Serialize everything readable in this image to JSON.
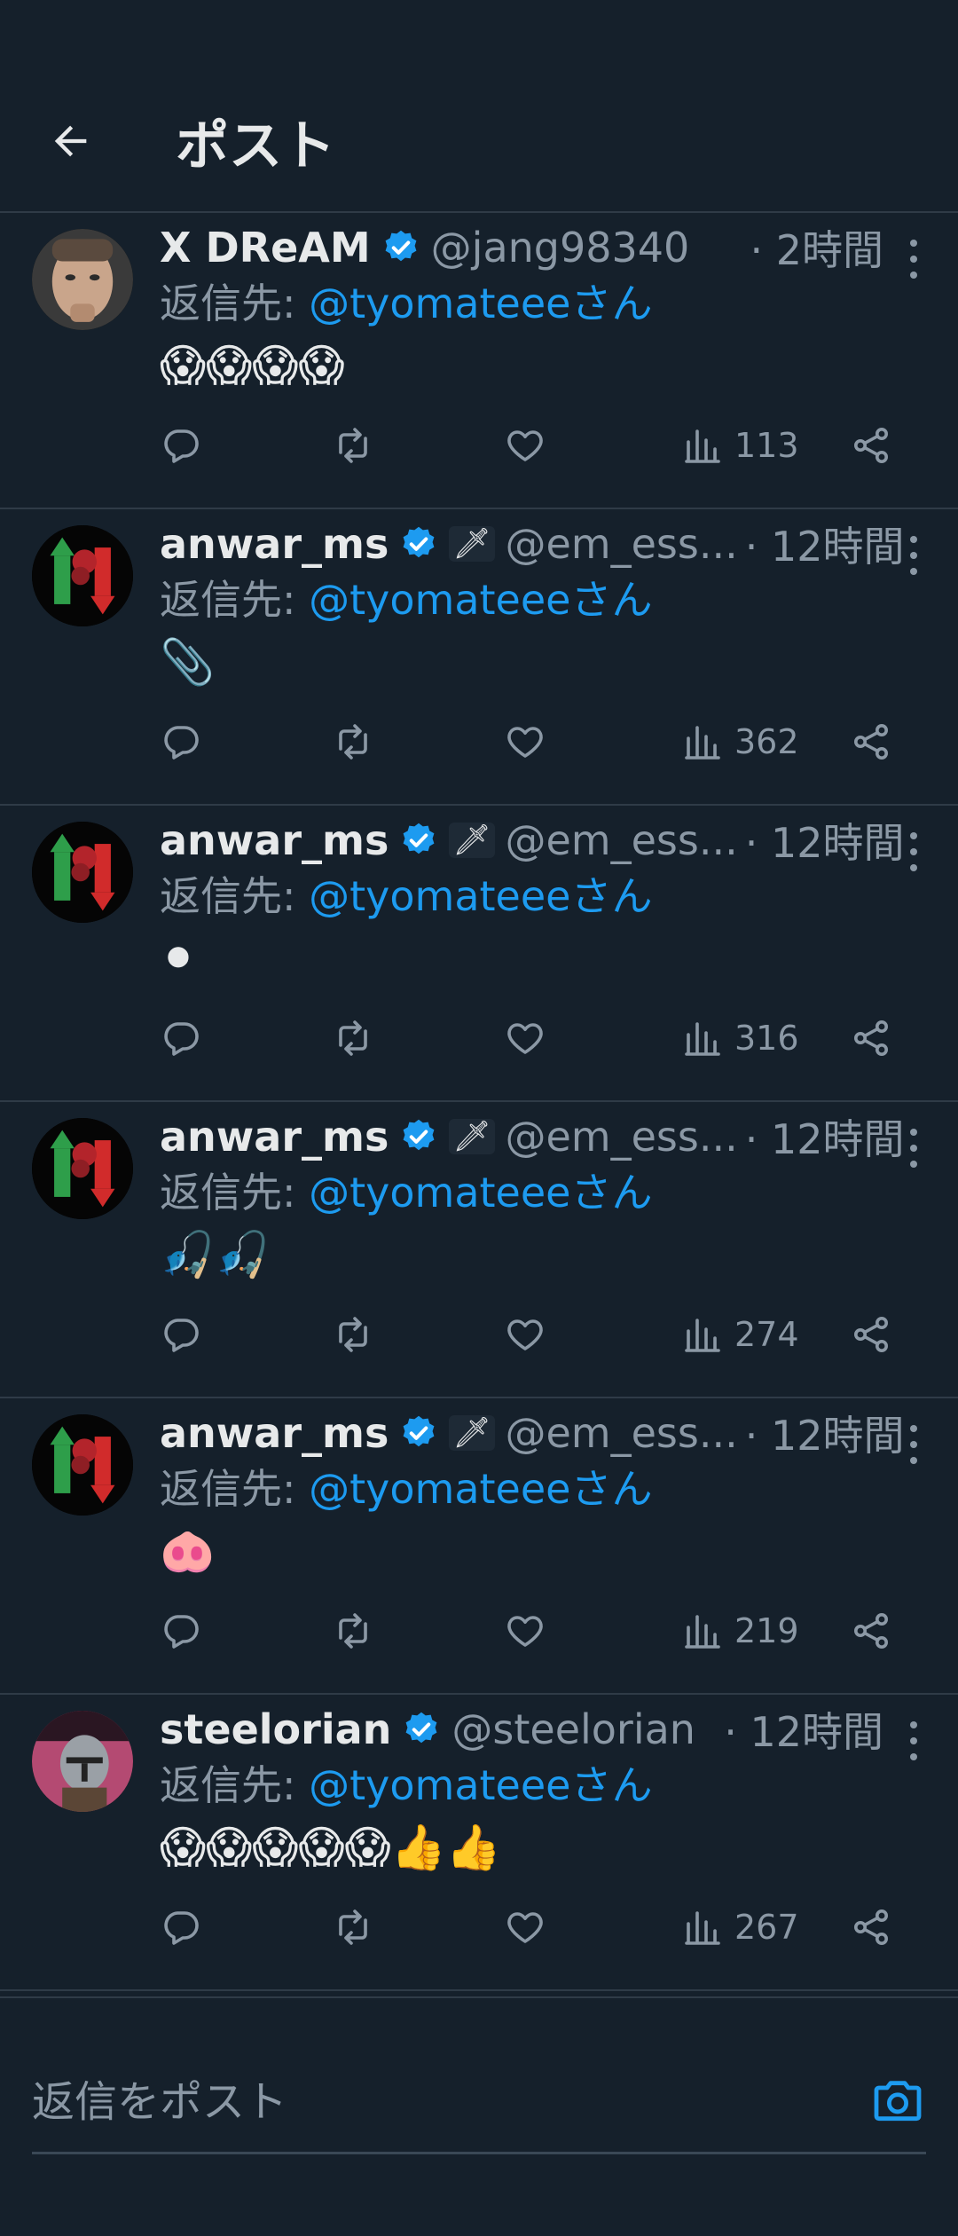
{
  "header": {
    "title": "ポスト"
  },
  "posts": [
    {
      "name": "X DReAM",
      "handle": "@jang98340",
      "time": "· 2時間",
      "reply_prefix": "返信先: ",
      "reply_to": "@tyomateeeさん",
      "content": "😱😱😱😱",
      "views": "113",
      "avatar": "face",
      "sword": false
    },
    {
      "name": "anwar_ms",
      "handle": "@em_ess...",
      "time": "· 12時間",
      "reply_prefix": "返信先: ",
      "reply_to": "@tyomateeeさん",
      "content": "📎",
      "views": "362",
      "avatar": "chart",
      "sword": true
    },
    {
      "name": "anwar_ms",
      "handle": "@em_ess...",
      "time": "· 12時間",
      "reply_prefix": "返信先: ",
      "reply_to": "@tyomateeeさん",
      "content": "⚫",
      "views": "316",
      "avatar": "chart",
      "sword": true
    },
    {
      "name": "anwar_ms",
      "handle": "@em_ess...",
      "time": "· 12時間",
      "reply_prefix": "返信先: ",
      "reply_to": "@tyomateeeさん",
      "content": "🎣🎣",
      "views": "274",
      "avatar": "chart",
      "sword": true
    },
    {
      "name": "anwar_ms",
      "handle": "@em_ess...",
      "time": "· 12時間",
      "reply_prefix": "返信先: ",
      "reply_to": "@tyomateeeさん",
      "content": "🐽",
      "views": "219",
      "avatar": "chart",
      "sword": true
    },
    {
      "name": "steelorian",
      "handle": "@steelorian",
      "time": "· 12時間",
      "reply_prefix": "返信先: ",
      "reply_to": "@tyomateeeさん",
      "content": "😱😱😱😱😱👍👍",
      "views": "267",
      "avatar": "helmet",
      "sword": false
    }
  ],
  "sword_glyph": "🗡",
  "reply_box": {
    "placeholder": "返信をポスト"
  },
  "colors": {
    "background": "#15202b",
    "accent": "#1d9bf0",
    "muted": "#8b98a5",
    "text": "#e7e9ea",
    "divider": "#2f3b47"
  },
  "icons": {
    "back": "arrow-left-icon",
    "verified": "verified-badge-icon",
    "reply": "reply-icon",
    "repost": "repost-icon",
    "like": "heart-icon",
    "views": "views-icon",
    "share": "share-icon",
    "more": "more-vertical-icon",
    "camera": "camera-icon"
  }
}
